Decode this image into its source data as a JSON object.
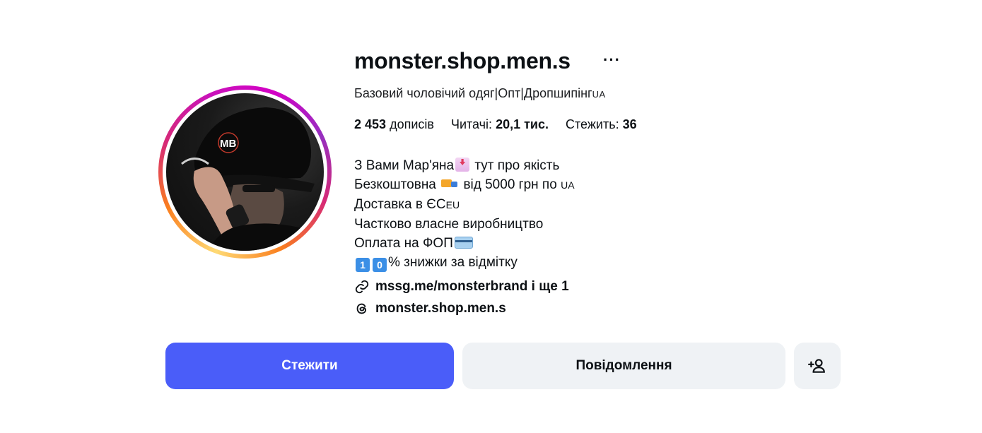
{
  "profile": {
    "username": "monster.shop.men.s",
    "more_label": "···",
    "category_text": "Базовий чоловічий одяг|Опт|Дропшипінг",
    "category_flag": "UA",
    "avatar_letters": "MB"
  },
  "stats": {
    "posts_value": "2 453",
    "posts_label": "дописів",
    "followers_label": "Читачі:",
    "followers_value": "20,1 тис.",
    "following_label": "Стежить:",
    "following_value": "36"
  },
  "bio": {
    "line1_a": "З Вами Мар'яна",
    "line1_b": "тут про якість",
    "line2_a": "Безкоштовна",
    "line2_b": "від 5000 грн по",
    "line2_flag": "UA",
    "line3_a": "Доставка в ЄС",
    "line3_flag": "EU",
    "line4": "Частково власне виробництво",
    "line5": "Оплата на ФОП",
    "line6_key1": "1",
    "line6_key2": "0",
    "line6_text": "% знижки за відмітку"
  },
  "links": {
    "website": "mssg.me/monsterbrand і ще 1",
    "threads": "monster.shop.men.s"
  },
  "actions": {
    "follow_label": "Стежити",
    "message_label": "Повідомлення"
  },
  "icons": {
    "link": "link-icon",
    "threads": "threads-icon",
    "add_person": "add-person-icon",
    "more": "more-horizontal-icon"
  },
  "colors": {
    "follow_button": "#4a5df9",
    "secondary_button": "#eff2f5",
    "text": "#0c1014"
  }
}
